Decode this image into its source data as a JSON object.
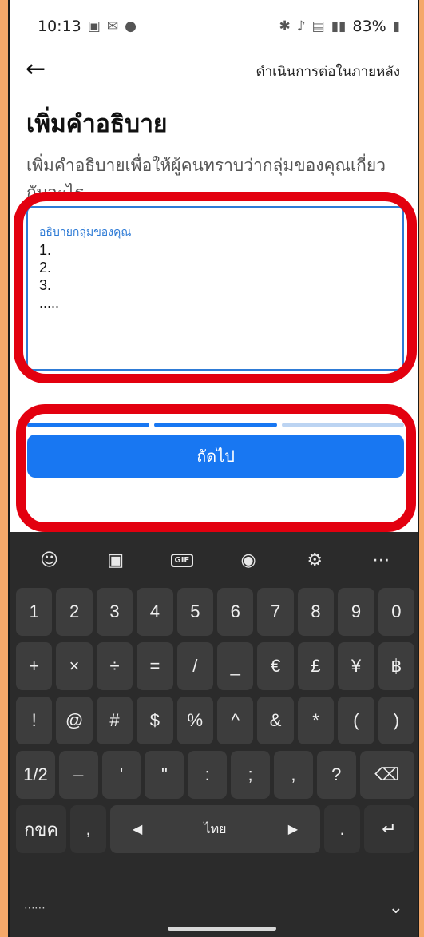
{
  "status_bar": {
    "time": "10:13",
    "battery": "83%"
  },
  "header": {
    "continue_later": "ดำเนินการต่อในภายหลัง"
  },
  "page": {
    "title": "เพิ่มคำอธิบาย",
    "subtitle": "เพิ่มคำอธิบายเพื่อให้ผู้คนทราบว่ากลุ่มของคุณเกี่ยวกับอะไร"
  },
  "description_field": {
    "label": "อธิบายกลุ่มของคุณ",
    "value": "1.\n2.\n3.\n....."
  },
  "progress": {
    "steps_total": 3,
    "steps_done": 2,
    "done_color": "#1877F2",
    "todo_color": "#BCD4F2"
  },
  "next_button": {
    "label": "ถัดไป"
  },
  "keyboard": {
    "row1": [
      "1",
      "2",
      "3",
      "4",
      "5",
      "6",
      "7",
      "8",
      "9",
      "0"
    ],
    "row2": [
      "+",
      "×",
      "÷",
      "=",
      "/",
      "_",
      "€",
      "£",
      "¥",
      "฿"
    ],
    "row3": [
      "!",
      "@",
      "#",
      "$",
      "%",
      "^",
      "&",
      "*",
      "(",
      ")"
    ],
    "row4": [
      "1/2",
      "–",
      "'",
      "\"",
      ":",
      ";",
      ",",
      "?"
    ],
    "row5_left": "กขค",
    "row5_comma": ",",
    "space_label": "ไทย",
    "row5_period": "."
  },
  "colors": {
    "accent": "#1877F2",
    "highlight": "#E3000F",
    "page_border": "#F5A86A"
  }
}
